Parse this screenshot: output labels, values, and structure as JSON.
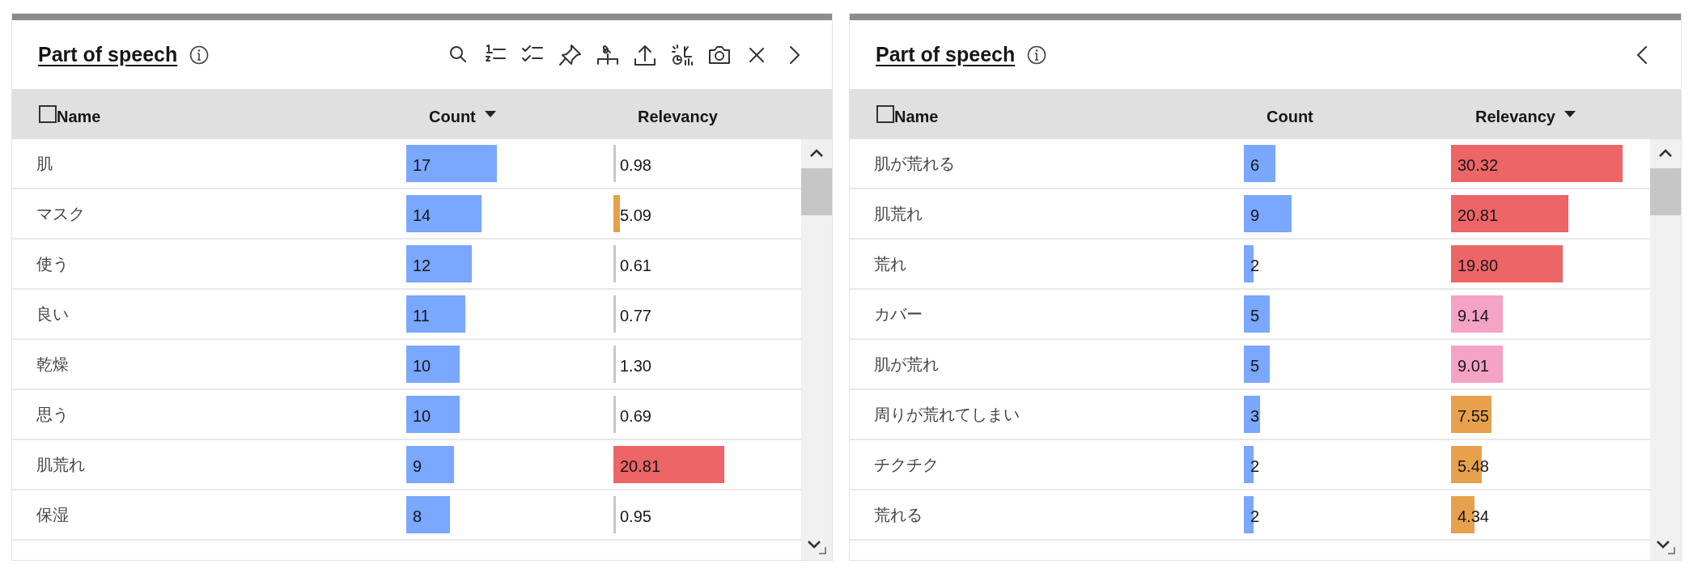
{
  "panels": [
    {
      "title": "Part of speech",
      "toolbar": [
        {
          "kind": "search"
        },
        {
          "kind": "numbered-list"
        },
        {
          "kind": "checklist"
        },
        {
          "kind": "pin"
        },
        {
          "kind": "split"
        },
        {
          "kind": "upload"
        },
        {
          "kind": "insight"
        },
        {
          "kind": "camera"
        },
        {
          "kind": "close"
        },
        {
          "kind": "chevron-right"
        }
      ],
      "select_all": {
        "checked": false
      },
      "columns": [
        {
          "label": "Name",
          "sorted": false
        },
        {
          "label": "Count",
          "sorted": true
        },
        {
          "label": "Relevancy",
          "sorted": false
        }
      ],
      "rows": [
        {
          "name": "肌",
          "count": {
            "value": "17",
            "level": 0.46
          },
          "relevancy": {
            "value": "0.98",
            "level": 0.012,
            "color": "#c8c8c8"
          }
        },
        {
          "name": "マスク",
          "count": {
            "value": "14",
            "level": 0.38
          },
          "relevancy": {
            "value": "5.09",
            "level": 0.035,
            "color": "#e7a04c"
          }
        },
        {
          "name": "使う",
          "count": {
            "value": "12",
            "level": 0.33
          },
          "relevancy": {
            "value": "0.61",
            "level": 0.008,
            "color": "#c8c8c8"
          }
        },
        {
          "name": "良い",
          "count": {
            "value": "11",
            "level": 0.3
          },
          "relevancy": {
            "value": "0.77",
            "level": 0.008,
            "color": "#c8c8c8"
          }
        },
        {
          "name": "乾燥",
          "count": {
            "value": "10",
            "level": 0.27
          },
          "relevancy": {
            "value": "1.30",
            "level": 0.015,
            "color": "#c8c8c8"
          }
        },
        {
          "name": "思う",
          "count": {
            "value": "10",
            "level": 0.27
          },
          "relevancy": {
            "value": "0.69",
            "level": 0.008,
            "color": "#c8c8c8"
          }
        },
        {
          "name": "肌荒れ",
          "count": {
            "value": "9",
            "level": 0.24
          },
          "relevancy": {
            "value": "20.81",
            "level": 0.61,
            "color": "#ec6567"
          }
        },
        {
          "name": "保湿",
          "count": {
            "value": "8",
            "level": 0.22
          },
          "relevancy": {
            "value": "0.95",
            "level": 0.008,
            "color": "#c8c8c8"
          }
        }
      ]
    },
    {
      "title": "Part of speech",
      "toolbar": [
        {
          "kind": "chevron-left"
        }
      ],
      "select_all": {
        "checked": false
      },
      "columns": [
        {
          "label": "Name",
          "sorted": false
        },
        {
          "label": "Count",
          "sorted": false
        },
        {
          "label": "Relevancy",
          "sorted": true
        }
      ],
      "rows": [
        {
          "name": "肌が荒れる",
          "count": {
            "value": "6",
            "level": 0.16
          },
          "relevancy": {
            "value": "30.32",
            "level": 0.89,
            "color": "#ec6567"
          }
        },
        {
          "name": "肌荒れ",
          "count": {
            "value": "9",
            "level": 0.24
          },
          "relevancy": {
            "value": "20.81",
            "level": 0.61,
            "color": "#ec6567"
          }
        },
        {
          "name": "荒れ",
          "count": {
            "value": "2",
            "level": 0.05
          },
          "relevancy": {
            "value": "19.80",
            "level": 0.58,
            "color": "#ec6567"
          }
        },
        {
          "name": "カバー",
          "count": {
            "value": "5",
            "level": 0.13
          },
          "relevancy": {
            "value": "9.14",
            "level": 0.27,
            "color": "#f4a3c4"
          }
        },
        {
          "name": "肌が荒れ",
          "count": {
            "value": "5",
            "level": 0.13
          },
          "relevancy": {
            "value": "9.01",
            "level": 0.27,
            "color": "#f4a3c4"
          }
        },
        {
          "name": "周りが荒れてしまい",
          "count": {
            "value": "3",
            "level": 0.08
          },
          "relevancy": {
            "value": "7.55",
            "level": 0.21,
            "color": "#e7a04c"
          }
        },
        {
          "name": "チクチク",
          "count": {
            "value": "2",
            "level": 0.05
          },
          "relevancy": {
            "value": "5.48",
            "level": 0.16,
            "color": "#e7a04c"
          }
        },
        {
          "name": "荒れる",
          "count": {
            "value": "2",
            "level": 0.05
          },
          "relevancy": {
            "value": "4.34",
            "level": 0.12,
            "color": "#e7a04c"
          }
        }
      ]
    }
  ]
}
